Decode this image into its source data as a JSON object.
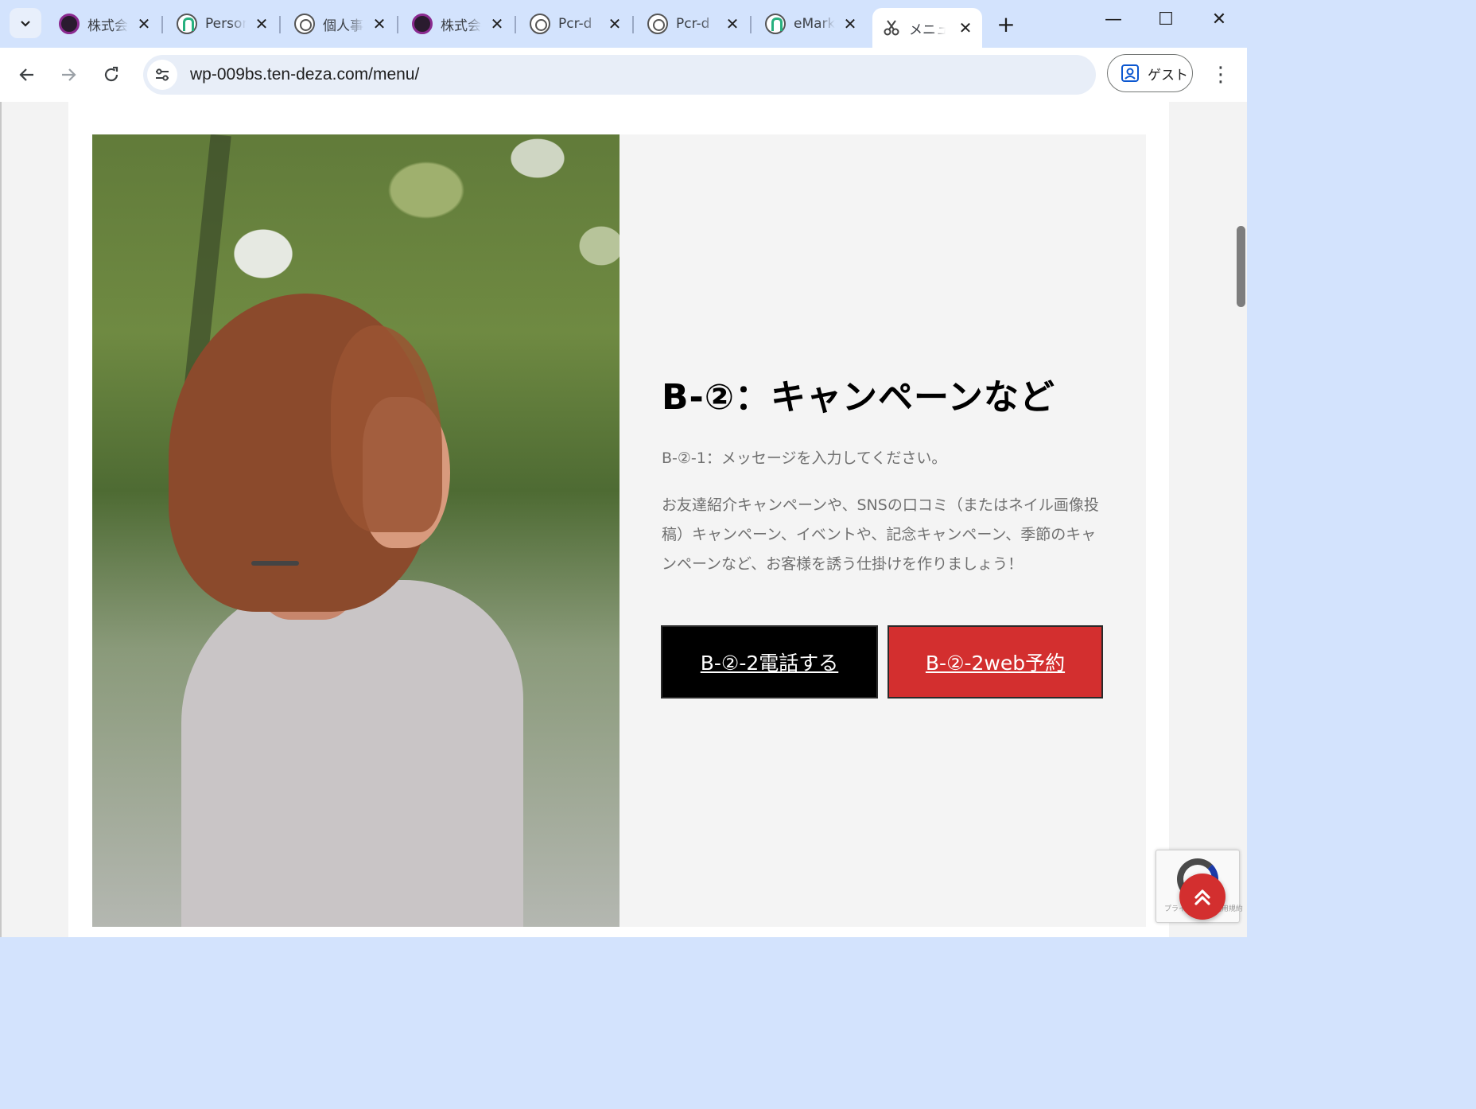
{
  "browser": {
    "tabs": [
      {
        "title": "株式会社",
        "favicon": "dark-circle-icon"
      },
      {
        "title": "Personal",
        "favicon": "green-app-icon"
      },
      {
        "title": "個人事業",
        "favicon": "globe-icon"
      },
      {
        "title": "株式会社",
        "favicon": "dark-circle-icon"
      },
      {
        "title": "Pcr-d",
        "favicon": "globe-icon"
      },
      {
        "title": "Pcr-d",
        "favicon": "globe-icon"
      },
      {
        "title": "eMarket",
        "favicon": "green-app-icon"
      },
      {
        "title": "メニュー",
        "favicon": "scissors-icon",
        "active": true
      }
    ],
    "url": "wp-009bs.ten-deza.com/menu/",
    "profile_label": "ゲスト"
  },
  "section": {
    "heading": "B-②：キャンペーンなど",
    "lead": "B-②-1：メッセージを入力してください。",
    "description": "お友達紹介キャンペーンや、SNSの口コミ（またはネイル画像投稿）キャンペーン、イベントや、記念キャンペーン、季節のキャンペーンなど、お客様を誘う仕掛けを作りましょう！",
    "buttons": {
      "tel_label": "B-②-2電話する",
      "web_label": "B-②-2web予約"
    }
  },
  "widgets": {
    "recaptcha_text": "プライバシー - 利用規約"
  },
  "colors": {
    "accent": "#d32f2f",
    "tab_strip": "#d3e3fd",
    "panel_bg": "#f4f4f4"
  }
}
